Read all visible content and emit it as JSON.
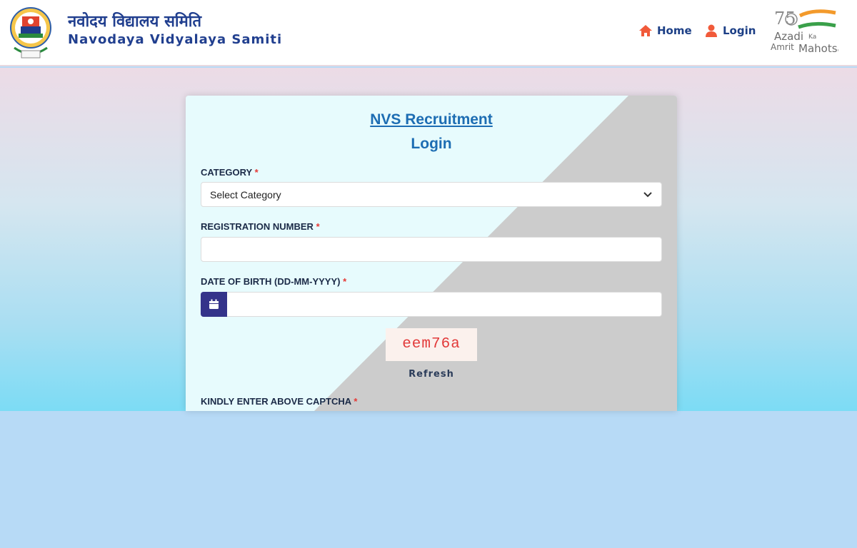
{
  "header": {
    "brand_hindi": "नवोदय विद्यालय समिति",
    "brand_english": "Navodaya Vidyalaya Samiti",
    "nav": {
      "home": "Home",
      "login": "Login"
    },
    "amrit": {
      "line1": "Azadi",
      "line2": "Ka",
      "line3": "Amrit",
      "line4": "Mahotsav"
    }
  },
  "form": {
    "title": "NVS Recruitment",
    "subtitle": "Login",
    "category": {
      "label": "CATEGORY",
      "required_mark": "*",
      "selected": "Select Category"
    },
    "registration": {
      "label": "REGISTRATION NUMBER",
      "required_mark": "*",
      "value": ""
    },
    "dob": {
      "label": "DATE OF BIRTH (DD-MM-YYYY)",
      "required_mark": "*",
      "value": ""
    },
    "captcha": {
      "code": "eem76a",
      "refresh_label": "Refresh",
      "label": "KINDLY ENTER ABOVE CAPTCHA",
      "required_mark": "*"
    }
  },
  "icons": {
    "home": "home-icon",
    "login": "user-icon",
    "calendar": "calendar-icon",
    "select": "chevron-down-icon"
  },
  "colors": {
    "brand_blue": "#213f8f",
    "nav_icon": "#f15a3a",
    "title_blue": "#1d6db3",
    "calendar_button": "#34338a",
    "captcha_text": "#e23a3a",
    "required": "#e53935"
  }
}
